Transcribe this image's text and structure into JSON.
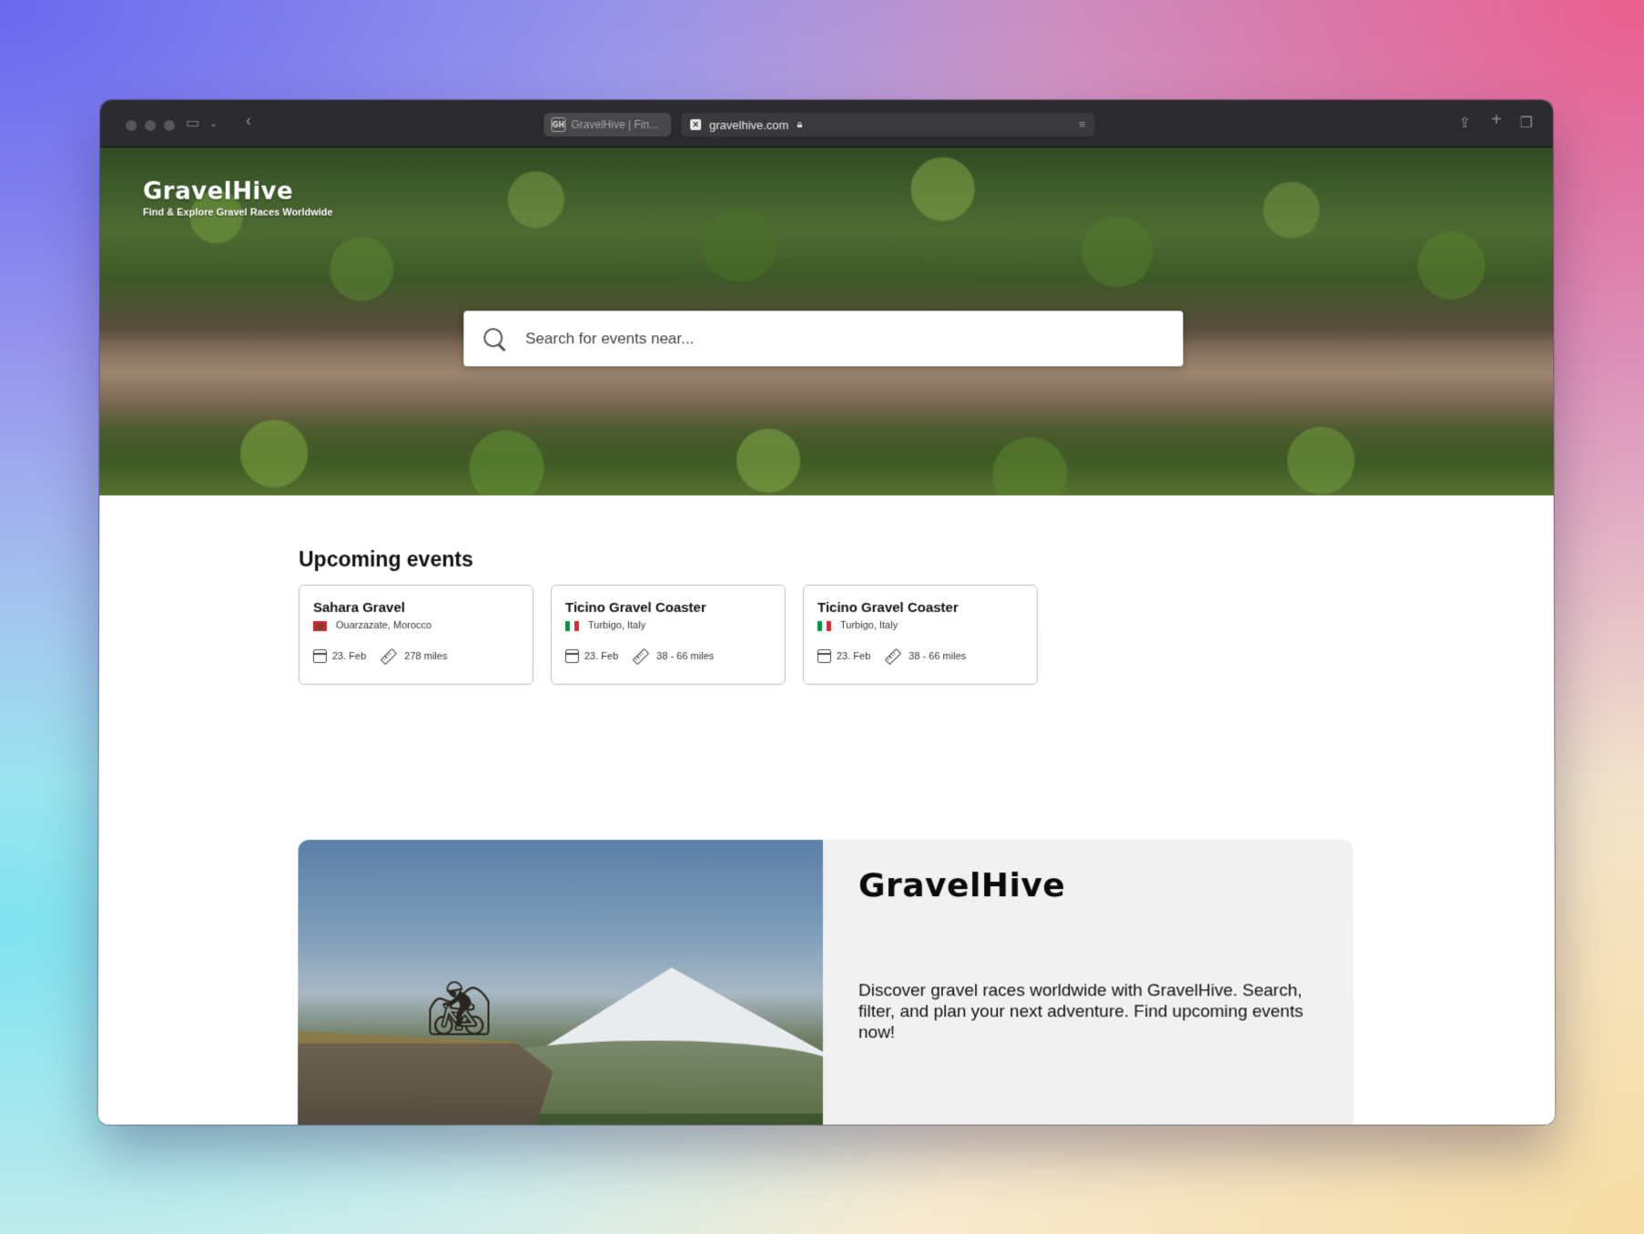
{
  "browser": {
    "tab": {
      "favicon": "GH",
      "title": "GravelHive | Fin..."
    },
    "address": {
      "url": "gravelhive.com"
    },
    "icons": [
      "sidebar-icon",
      "chevron-down-icon",
      "back-icon",
      "share-icon",
      "new-tab-icon",
      "tabs-overview-icon"
    ]
  },
  "hero": {
    "logo": "GravelHive",
    "tagline": "Find & Explore Gravel Races Worldwide",
    "search": {
      "placeholder": "Search for events near...",
      "value": ""
    }
  },
  "upcoming": {
    "title": "Upcoming events",
    "events": [
      {
        "name": "Sahara Gravel",
        "location": "Ouarzazate, Morocco",
        "flag": "MA",
        "date": "23. Feb",
        "distance": "278 miles"
      },
      {
        "name": "Ticino Gravel Coaster",
        "location": "Turbigo, Italy",
        "flag": "IT",
        "date": "23. Feb",
        "distance": "38 - 66 miles"
      },
      {
        "name": "Ticino Gravel Coaster",
        "location": "Turbigo, Italy",
        "flag": "IT",
        "date": "23. Feb",
        "distance": "38 - 66 miles"
      }
    ]
  },
  "promo": {
    "logo": "GravelHive",
    "description": "Discover gravel races worldwide with GravelHive. Search, filter, and plan your next adventure. Find upcoming events now!"
  }
}
